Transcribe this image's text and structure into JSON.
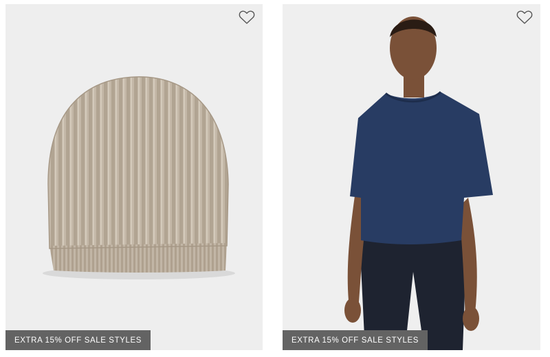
{
  "products": [
    {
      "badge": "EXTRA 15% OFF SALE STYLES",
      "wishlist_icon": "heart-outline-icon",
      "image_subject": "beanie"
    },
    {
      "badge": "EXTRA 15% OFF SALE STYLES",
      "wishlist_icon": "heart-outline-icon",
      "image_subject": "model-in-navy-tee"
    }
  ],
  "colors": {
    "card_background": "#eeeeee",
    "badge_background": "#636363",
    "heart_stroke": "#555555",
    "beanie": "#bfb3a3",
    "tee": "#283c63",
    "jeans": "#1e2330",
    "skin": "#7a5138"
  }
}
